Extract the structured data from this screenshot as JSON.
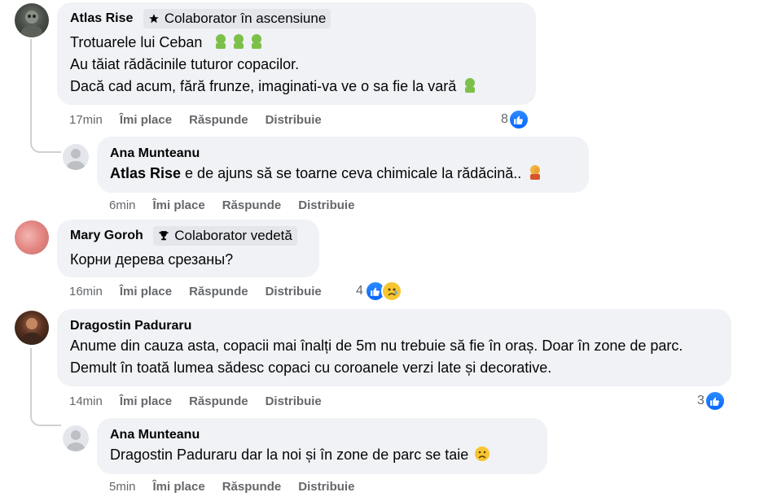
{
  "comments": [
    {
      "author": "Atlas Rise",
      "badge": "Colaborator în ascensiune",
      "badge_icon": "star-icon",
      "lines": [
        "Trotuarele lui Ceban",
        "Au tăiat rădăcinile tuturor copacilor.",
        "Dacă cad acum, fără frunze, imaginati-va ve o sa fie la vară"
      ],
      "emoji": "nauseated-face",
      "time": "17min",
      "like": "Îmi place",
      "reply": "Răspunde",
      "share": "Distribuie",
      "reaction_count": "8"
    },
    {
      "author": "Ana Munteanu",
      "mention": "Atlas Rise",
      "text": " e de ajuns să se toarne ceva chimicale la rădăcină..",
      "emoji": "facepalm",
      "time": "6min",
      "like": "Îmi place",
      "reply": "Răspunde",
      "share": "Distribuie"
    },
    {
      "author": "Mary Goroh",
      "badge": "Colaborator vedetă",
      "badge_icon": "trophy-icon",
      "text": "Корни дерева срезаны?",
      "time": "16min",
      "like": "Îmi place",
      "reply": "Răspunde",
      "share": "Distribuie",
      "reaction_count": "4"
    },
    {
      "author": "Dragostin Paduraru",
      "text": "Anume din cauza asta, copacii mai înalți de 5m nu trebuie să fie în oraș. Doar în zone de parc. Demult în toată lumea sădesc copaci cu coroanele verzi late și decorative.",
      "time": "14min",
      "like": "Îmi place",
      "reply": "Răspunde",
      "share": "Distribuie",
      "reaction_count": "3"
    },
    {
      "author": "Ana Munteanu",
      "text": "Dragostin Paduraru dar la noi și în zone de parc se taie",
      "emoji": "sad-face",
      "time": "5min",
      "like": "Îmi place",
      "reply": "Răspunde",
      "share": "Distribuie"
    }
  ],
  "colors": {
    "bubble": "#f0f2f5",
    "meta_text": "#65676b",
    "like_blue": "#0866ff",
    "thread_line": "#ced0d4"
  }
}
